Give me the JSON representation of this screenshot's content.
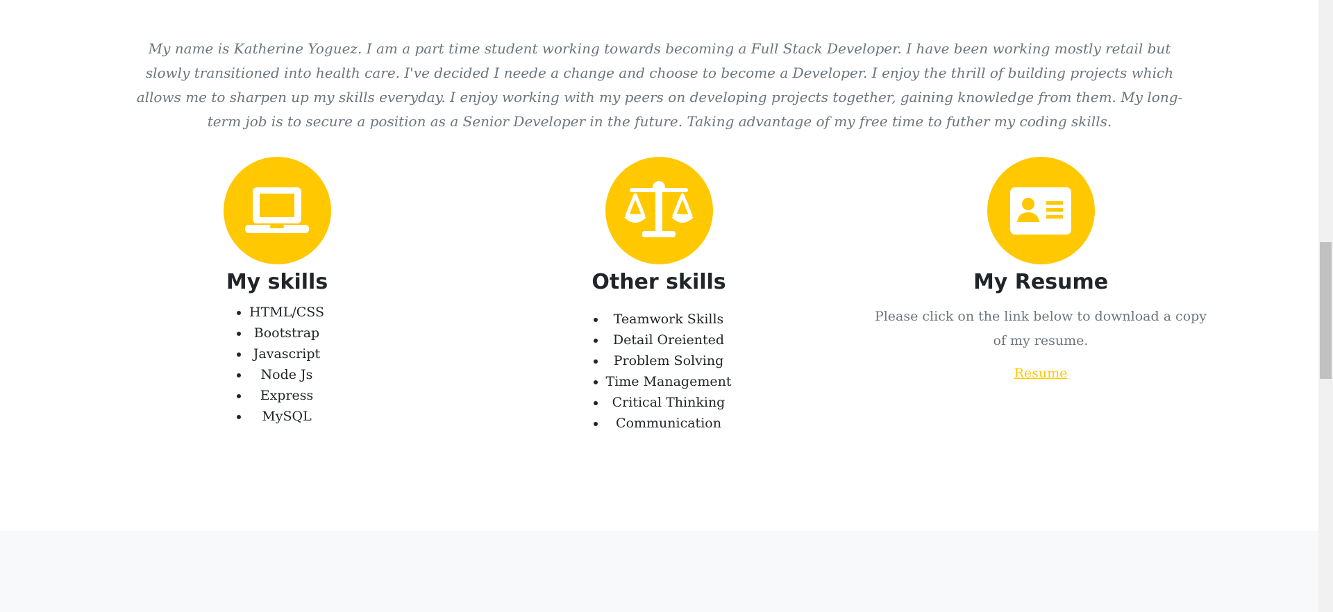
{
  "about": {
    "intro": "My name is Katherine Yoguez. I am a part time student working towards becoming a Full Stack Developer. I have been working mostly retail but slowly transitioned into health care. I've decided I neede a change and choose to become a Developer. I enjoy the thrill of building projects which allows me to sharpen up my skills everyday. I enjoy working with my peers on developing projects together, gaining knowledge from them. My long-term job is to secure a position as a Senior Developer in the future. Taking advantage of my free time to futher my coding skills."
  },
  "columns": {
    "skills": {
      "icon": "laptop-icon",
      "title": "My skills",
      "items": [
        "HTML/CSS",
        "Bootstrap",
        "Javascript",
        "Node Js",
        "Express",
        "MySQL"
      ]
    },
    "other": {
      "icon": "balance-scale-icon",
      "title": "Other skills",
      "items": [
        "Teamwork Skills",
        "Detail Oreiented",
        "Problem Solving",
        "Time Management",
        "Critical Thinking",
        "Communication"
      ]
    },
    "resume": {
      "icon": "id-card-icon",
      "title": "My Resume",
      "text": "Please click on the link below to download a copy of my resume.",
      "link": "Resume"
    }
  },
  "colors": {
    "accent": "#ffc800",
    "heading": "#212529",
    "muted": "#6c757d",
    "footer_bg": "#f8f9fa"
  }
}
